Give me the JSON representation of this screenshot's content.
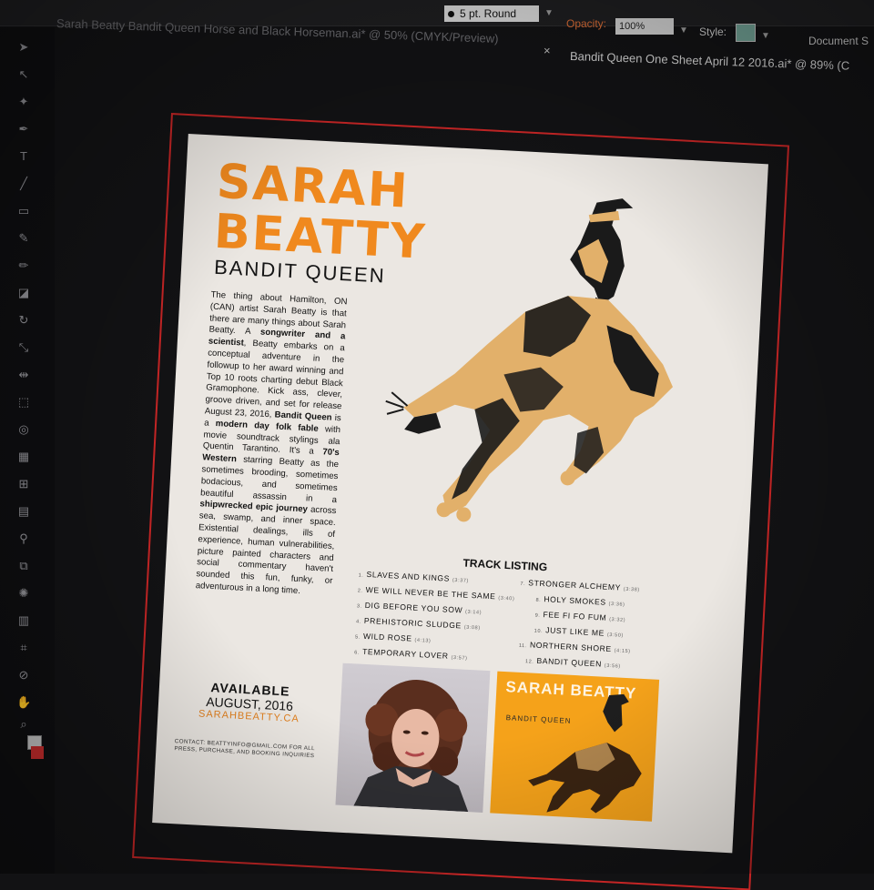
{
  "control_bar": {
    "brush_value": "5 pt. Round",
    "opacity_label": "Opacity:",
    "opacity_value": "100%",
    "style_label": "Style:",
    "document_label": "Document S",
    "style_swatch_color": "#6f9e92"
  },
  "tabs": {
    "inactive_tab_title": "Sarah Beatty Bandit Queen Horse and Black Horseman.ai* @ 50% (CMYK/Preview)",
    "close_symbol": "×",
    "active_tab_title": "Bandit Queen One Sheet April 12 2016.ai* @ 89% (C"
  },
  "toolbar": {
    "tools": [
      "selection-tool-icon",
      "direct-selection-tool-icon",
      "magic-wand-icon",
      "pen-tool-icon",
      "type-tool-icon",
      "line-tool-icon",
      "rectangle-tool-icon",
      "paintbrush-tool-icon",
      "pencil-tool-icon",
      "eraser-tool-icon",
      "rotate-tool-icon",
      "scale-tool-icon",
      "width-tool-icon",
      "free-transform-icon",
      "shape-builder-icon",
      "perspective-grid-icon",
      "mesh-tool-icon",
      "gradient-tool-icon",
      "eyedropper-tool-icon",
      "blend-tool-icon",
      "symbol-sprayer-icon",
      "column-graph-icon",
      "artboard-tool-icon",
      "slice-tool-icon",
      "hand-tool-icon",
      "zoom-tool-icon"
    ],
    "fill_color": "#c0c0c0",
    "stroke_color": "#c32c2c"
  },
  "one_sheet": {
    "artist_name": "SARAH BEATTY",
    "album_title": "BANDIT QUEEN",
    "bio": [
      {
        "text": "The thing about Hamilton, ON (CAN) artist Sarah Beatty is that there are many things about Sarah Beatty. A ",
        "bold": false
      },
      {
        "text": "songwriter and a scientist",
        "bold": true
      },
      {
        "text": ", Beatty embarks on a conceptual adventure in the followup to her award winning and Top 10 roots charting debut Black Gramophone. Kick ass, clever, groove driven, and set for release August 23, 2016, ",
        "bold": false
      },
      {
        "text": "Bandit Queen",
        "bold": true
      },
      {
        "text": " is a ",
        "bold": false
      },
      {
        "text": "modern day folk fable",
        "bold": true
      },
      {
        "text": " with movie soundtrack stylings ala Quentin Tarantino. It's a ",
        "bold": false
      },
      {
        "text": "70's Western",
        "bold": true
      },
      {
        "text": " starring Beatty as the sometimes brooding, sometimes bodacious, and sometimes beautiful assassin in a ",
        "bold": false
      },
      {
        "text": "shipwrecked epic journey",
        "bold": true
      },
      {
        "text": " across sea, swamp, and inner space. Existential dealings, ills of experience, human vulnerabilities, picture painted characters and social commentary haven't sounded this fun, funky, or adventurous in a long time.",
        "bold": false
      }
    ],
    "available_title": "AVAILABLE",
    "available_date": "AUGUST, 2016",
    "website": "SARAHBEATTY.CA",
    "contact": "CONTACT: BEATTYINFO@GMAIL.COM FOR ALL PRESS, PURCHASE, AND BOOKING INQUIRIES",
    "track_listing_title": "TRACK LISTING",
    "tracks_left": [
      {
        "num": "1.",
        "title": "SLAVES AND KINGS",
        "duration": "(3:37)"
      },
      {
        "num": "2.",
        "title": "WE WILL NEVER BE THE SAME",
        "duration": "(3:40)"
      },
      {
        "num": "3.",
        "title": "DIG BEFORE YOU SOW",
        "duration": "(3:14)"
      },
      {
        "num": "4.",
        "title": "PREHISTORIC SLUDGE",
        "duration": "(3:08)"
      },
      {
        "num": "5.",
        "title": "WILD ROSE",
        "duration": "(4:13)"
      },
      {
        "num": "6.",
        "title": "TEMPORARY LOVER",
        "duration": "(3:57)"
      }
    ],
    "tracks_right": [
      {
        "num": "7.",
        "title": "STRONGER ALCHEMY",
        "duration": "(3:38)"
      },
      {
        "num": "8.",
        "title": "HOLY SMOKES",
        "duration": "(3:36)"
      },
      {
        "num": "9.",
        "title": "FEE FI FO FUM",
        "duration": "(3:32)"
      },
      {
        "num": "10.",
        "title": "JUST LIKE ME",
        "duration": "(3:50)"
      },
      {
        "num": "11.",
        "title": "NORTHERN SHORE",
        "duration": "(4:15)"
      },
      {
        "num": "12.",
        "title": "BANDIT QUEEN",
        "duration": "(3:56)"
      }
    ],
    "cover_artist": "SARAH BEATTY",
    "cover_album": "BANDIT QUEEN",
    "colors": {
      "accent_orange": "#f0891e",
      "horse_tan": "#e2b06a",
      "cover_orange": "#f5a21a",
      "bleed_red": "#c42525"
    }
  }
}
